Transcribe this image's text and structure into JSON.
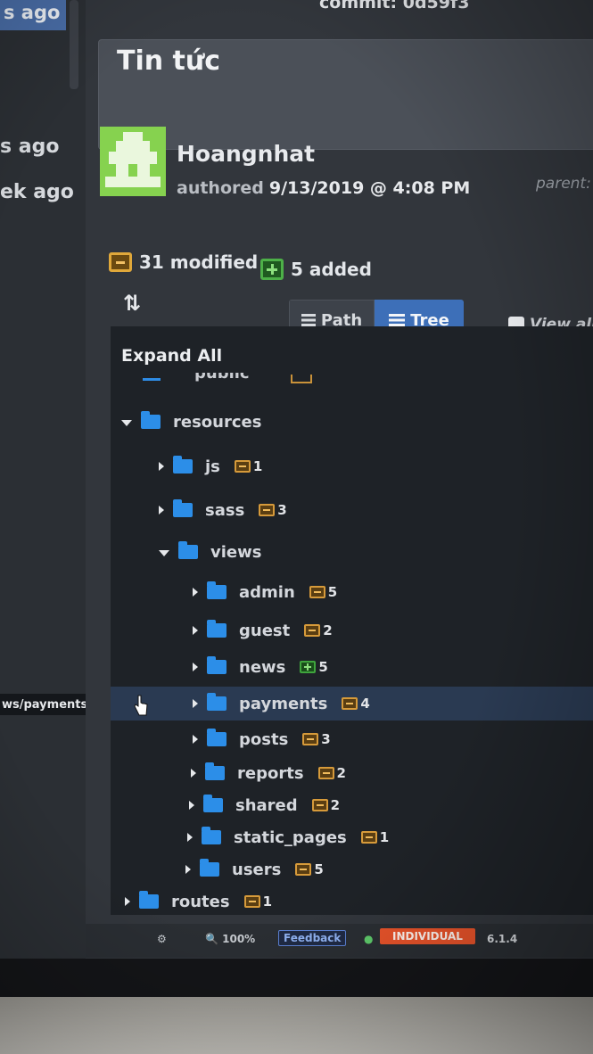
{
  "history": {
    "top_item_text": "s ago",
    "items": [
      {
        "time": "s ago"
      },
      {
        "time": "ek ago"
      }
    ],
    "hover_path": "ws/payments"
  },
  "commit": {
    "header_text": "commit: 0d59f3",
    "message": "Tin tức",
    "author": "Hoangnhat",
    "authored_label": "authored",
    "authored_date": "9/13/2019 @ 4:08 PM",
    "parent_label": "parent:",
    "modified_text": "31 modified",
    "added_text": "5 added"
  },
  "view": {
    "sort_icon": "⇅",
    "path_label": "Path",
    "tree_label": "Tree",
    "view_all_label": "View all",
    "selected": "Tree"
  },
  "tree": {
    "expand_all_label": "Expand All",
    "cut_row_text": "public",
    "rows": [
      {
        "name": "resources",
        "state": "open",
        "depth": 0,
        "count": "",
        "kind": ""
      },
      {
        "name": "js",
        "state": "closed",
        "depth": 1,
        "count": "1",
        "kind": "modified"
      },
      {
        "name": "sass",
        "state": "closed",
        "depth": 1,
        "count": "3",
        "kind": "modified"
      },
      {
        "name": "views",
        "state": "open",
        "depth": 1,
        "count": "",
        "kind": ""
      },
      {
        "name": "admin",
        "state": "closed",
        "depth": 2,
        "count": "5",
        "kind": "modified"
      },
      {
        "name": "guest",
        "state": "closed",
        "depth": 2,
        "count": "2",
        "kind": "modified"
      },
      {
        "name": "news",
        "state": "closed",
        "depth": 2,
        "count": "5",
        "kind": "added"
      },
      {
        "name": "payments",
        "state": "closed",
        "depth": 2,
        "count": "4",
        "kind": "modified",
        "selected": true
      },
      {
        "name": "posts",
        "state": "closed",
        "depth": 2,
        "count": "3",
        "kind": "modified"
      },
      {
        "name": "reports",
        "state": "closed",
        "depth": 2,
        "count": "2",
        "kind": "modified"
      },
      {
        "name": "shared",
        "state": "closed",
        "depth": 2,
        "count": "2",
        "kind": "modified"
      },
      {
        "name": "static_pages",
        "state": "closed",
        "depth": 2,
        "count": "1",
        "kind": "modified"
      },
      {
        "name": "users",
        "state": "closed",
        "depth": 2,
        "count": "5",
        "kind": "modified"
      },
      {
        "name": "routes",
        "state": "closed",
        "depth": 0,
        "count": "1",
        "kind": "modified"
      }
    ]
  },
  "status_bar": {
    "bug_icon": "bug-icon",
    "zoom": "100%",
    "feedback_label": "Feedback",
    "tier": "INDIVIDUAL",
    "version": "6.1.4"
  },
  "colors": {
    "accent": "#3d6fb8",
    "folder": "#2c8ee8",
    "modified": "#d69a3a",
    "added": "#3fa53d",
    "tier": "#e8532a"
  }
}
